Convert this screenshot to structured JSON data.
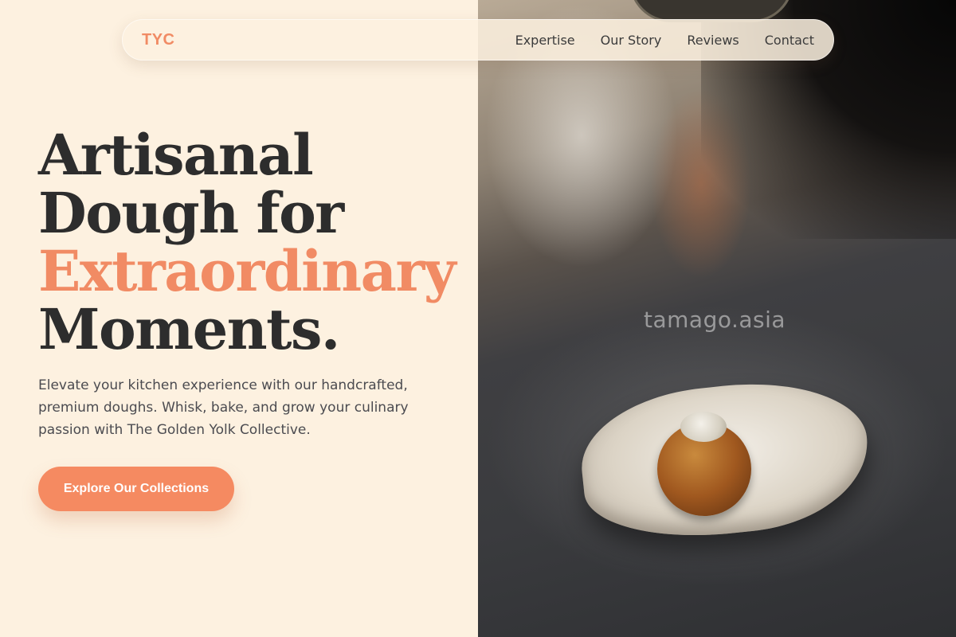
{
  "nav": {
    "brand": "TYC",
    "links": [
      "Expertise",
      "Our Story",
      "Reviews",
      "Contact"
    ]
  },
  "hero": {
    "title_lines": [
      "Artisanal",
      "Dough for",
      "Extraordinary",
      "Moments."
    ],
    "subtitle": "Elevate your kitchen experience with our handcrafted, premium doughs. Whisk, bake, and grow your culinary passion with The Golden Yolk Collective.",
    "cta_label": "Explore Our Collections"
  },
  "image": {
    "watermark": "tamago.asia"
  },
  "colors": {
    "accent": "#f18b64",
    "button": "#f58a61",
    "background": "#fdf1e0",
    "heading": "#2d2d2d",
    "body_text": "#4b4b50"
  }
}
